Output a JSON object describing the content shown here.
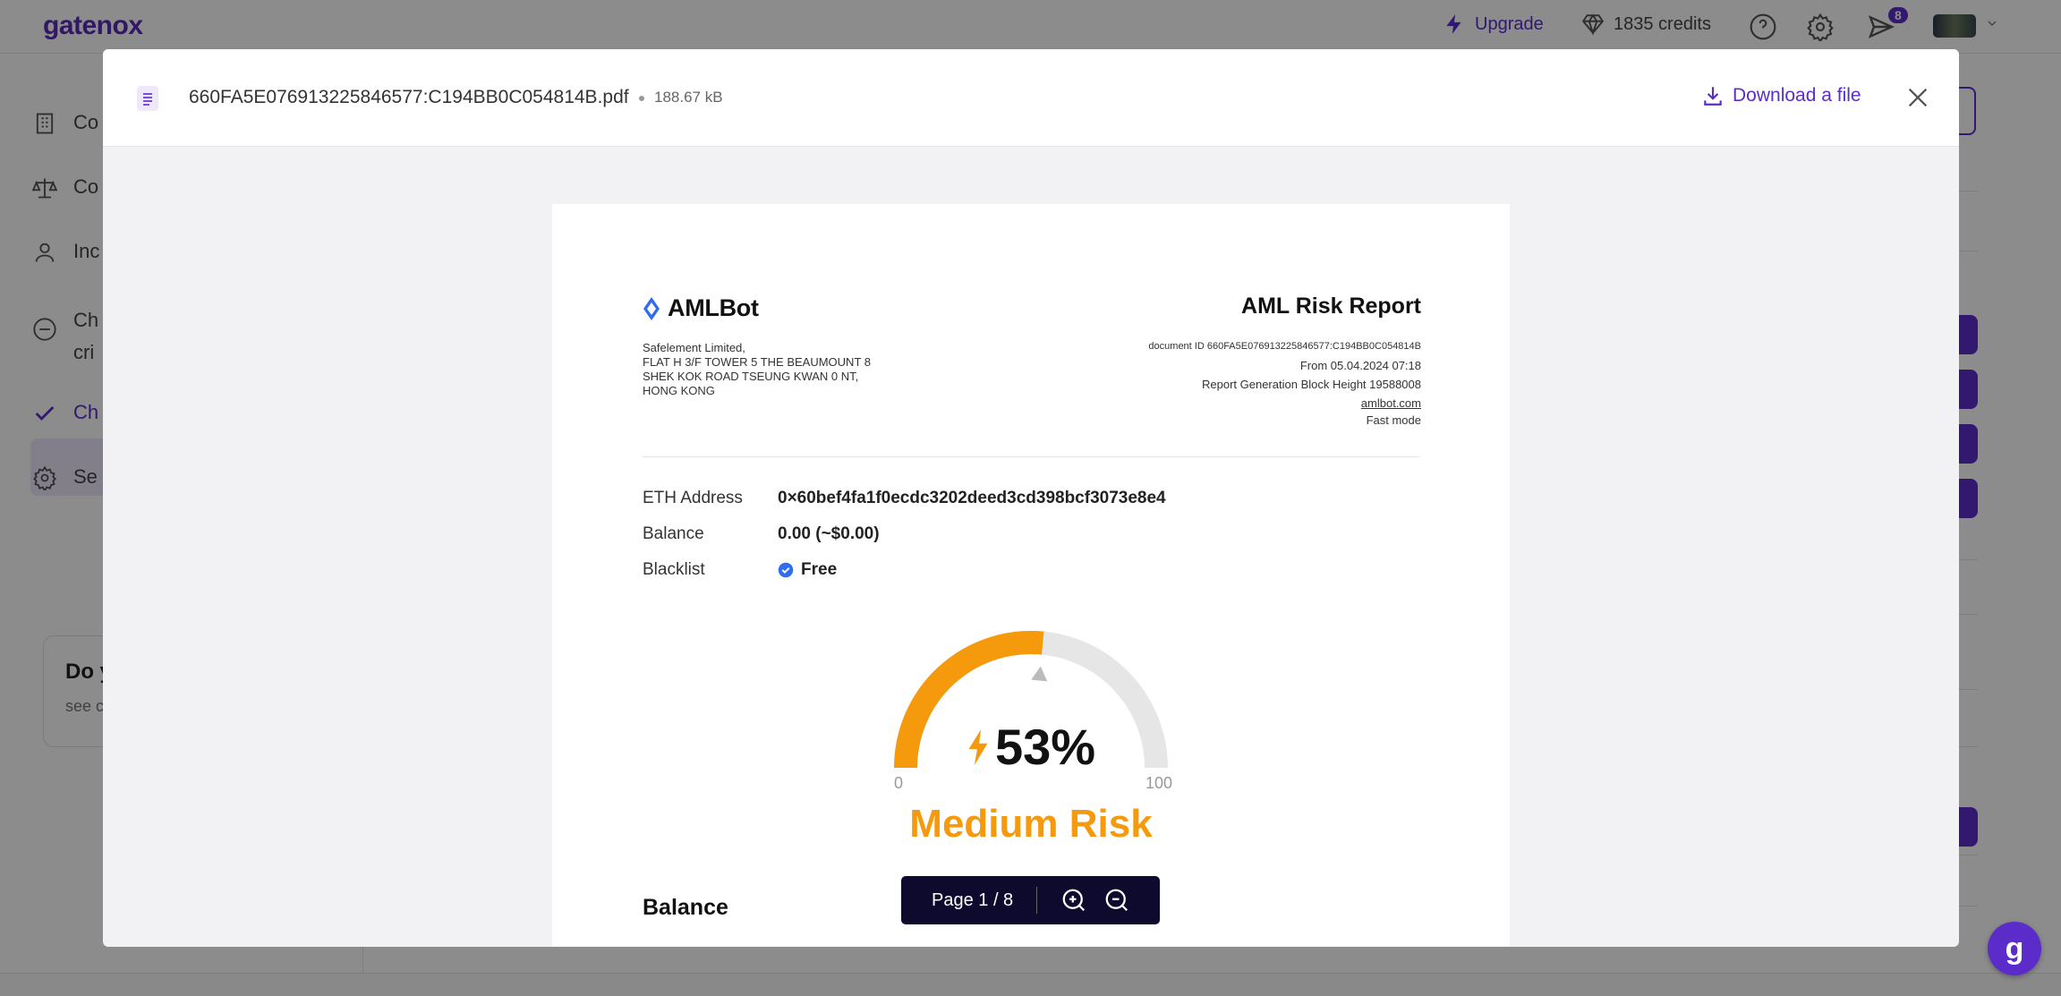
{
  "app": {
    "logo": "gatenox",
    "upgrade_label": "Upgrade",
    "credits_label": "1835 credits",
    "notification_count": "8"
  },
  "sidebar": {
    "items": [
      {
        "label": "Co",
        "icon": "building-icon"
      },
      {
        "label": "Co",
        "icon": "scale-icon"
      },
      {
        "label": "Inc",
        "icon": "person-icon"
      },
      {
        "label": "Ch\ncri",
        "icon": "minus-circle-icon"
      },
      {
        "label": "Ch",
        "icon": "check-icon",
        "active": true
      },
      {
        "label": "Se",
        "icon": "gear-icon"
      }
    ],
    "help_title": "Do y",
    "help_sub": "see c"
  },
  "modal": {
    "file_name": "660FA5E076913225846577:C194BB0C054814B.pdf",
    "file_size": "188.67 kB",
    "download_label": "Download a file"
  },
  "report": {
    "brand": "AMLBot",
    "company_lines": [
      "Safelement Limited,",
      "FLAT H 3/F TOWER 5 THE BEAUMOUNT 8",
      "SHEK KOK ROAD TSEUNG KWAN 0 NT,",
      "HONG KONG"
    ],
    "title": "AML Risk Report",
    "document_id": "document ID 660FA5E076913225846577:C194BB0C054814B",
    "from": "From 05.04.2024 07:18",
    "block_height": "Report Generation Block Height 19588008",
    "site": "amlbot.com",
    "mode": "Fast mode",
    "fields": {
      "address_label": "ETH Address",
      "address_value": "0×60bef4fa1f0ecdc3202deed3cd398bcf3073e8e4",
      "balance_label": "Balance",
      "balance_value": "0.00 (~$0.00)",
      "blacklist_label": "Blacklist",
      "blacklist_value": "Free"
    },
    "risk": {
      "score_percent": 53,
      "score_label": "53%",
      "min_label": "0",
      "max_label": "100",
      "level": "Medium Risk",
      "color": "#f59a0c"
    },
    "section_heading": "Balance"
  },
  "pager": {
    "label": "Page 1 / 8"
  },
  "colors": {
    "accent": "#5b2cc9",
    "risk_orange": "#f59a0c",
    "pager_bg": "#0d0a2e"
  }
}
